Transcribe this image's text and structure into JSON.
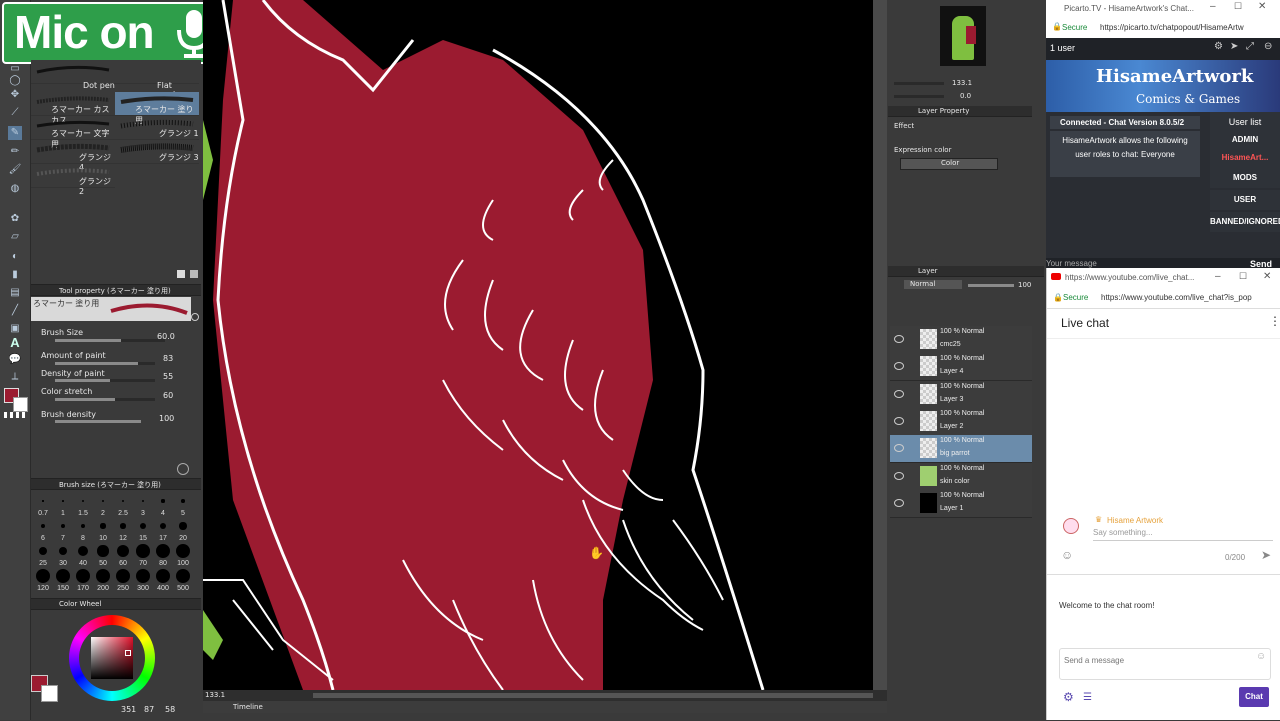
{
  "overlay": {
    "mic_label": "Mic on"
  },
  "brushes": {
    "items": [
      {
        "label": "Dot pen"
      },
      {
        "label": "Flat marker"
      },
      {
        "label": "ろマーカー カスカス"
      },
      {
        "label": "ろマーカー 塗り用"
      },
      {
        "label": "ろマーカー 文字用"
      },
      {
        "label": "グランジ 1"
      },
      {
        "label": "グランジ 4"
      },
      {
        "label": "グランジ 3"
      },
      {
        "label": "グランジ 2"
      }
    ]
  },
  "tool_property": {
    "header": "Tool property (ろマーカー 塗り用)",
    "brush_name": "ろマーカー 塗り用",
    "brush_size_label": "Brush Size",
    "brush_size_value": "60.0",
    "amount_label": "Amount of paint",
    "amount_value": "83",
    "density_label": "Density of paint",
    "density_value": "55",
    "stretch_label": "Color stretch",
    "stretch_value": "60",
    "brush_density_label": "Brush density",
    "brush_density_value": "100",
    "brush_size_fraction": 0.6,
    "amount_fraction": 0.83,
    "density_fraction": 0.55,
    "stretch_fraction": 0.6,
    "brush_density_fraction": 1.0
  },
  "brush_size_palette": {
    "header": "Brush size (ろマーカー 塗り用)",
    "sizes": [
      "0.7",
      "1",
      "1.5",
      "2",
      "2.5",
      "3",
      "4",
      "5",
      "6",
      "7",
      "8",
      "10",
      "12",
      "15",
      "17",
      "20",
      "25",
      "30",
      "40",
      "50",
      "60",
      "70",
      "80",
      "100",
      "120",
      "150",
      "170",
      "200",
      "250",
      "300",
      "400",
      "500"
    ]
  },
  "color_wheel": {
    "header": "Color Wheel",
    "coords": "351",
    "v1": "87",
    "v2": "58",
    "main_color": "#9b1b30"
  },
  "canvas": {
    "zoom": "133.1",
    "timeline_label": "Timeline"
  },
  "navigator": {
    "zoom": "133.1",
    "rotate": "0.0"
  },
  "layer_property": {
    "header": "Layer Property",
    "effect_label": "Effect",
    "expression_label": "Expression color",
    "expression_value": "Color"
  },
  "layer_panel": {
    "header": "Layer",
    "blend_mode": "Normal",
    "opacity": "100",
    "layers": [
      {
        "mode": "100 % Normal",
        "name": "cmc25"
      },
      {
        "mode": "100 % Normal",
        "name": "Layer 4"
      },
      {
        "mode": "100 % Normal",
        "name": "Layer 3"
      },
      {
        "mode": "100 % Normal",
        "name": "Layer 2"
      },
      {
        "mode": "100 % Normal",
        "name": "big parrot"
      },
      {
        "mode": "100 % Normal",
        "name": "skin color"
      },
      {
        "mode": "100 % Normal",
        "name": "Layer 1"
      }
    ]
  },
  "picarto": {
    "tab_title": "Picarto.TV - HisameArtwork's Chat...",
    "secure": "Secure",
    "url": "https://picarto.tv/chatpopout/HisameArtw",
    "users": "1 user",
    "banner_title": "HisameArtwork",
    "banner_sub": "Comics & Games",
    "connected": "Connected - Chat Version 8.0.5/2",
    "notice": "HisameArtwork allows the following user roles to chat: Everyone",
    "userlist_header": "User list",
    "roles": [
      "ADMIN",
      "HisameArt...",
      "MODS",
      "USER",
      "BANNED/IGNORED"
    ],
    "your_message": "Your message",
    "send": "Send"
  },
  "youtube": {
    "tab_title": "https://www.youtube.com/live_chat...",
    "secure": "Secure",
    "url": "https://www.youtube.com/live_chat?is_pop",
    "live_chat": "Live chat",
    "author": "Hisame Artwork",
    "input_placeholder": "Say something...",
    "counter": "0/200",
    "welcome": "Welcome to the chat room!",
    "send_placeholder": "Send a message",
    "chat_button": "Chat"
  }
}
